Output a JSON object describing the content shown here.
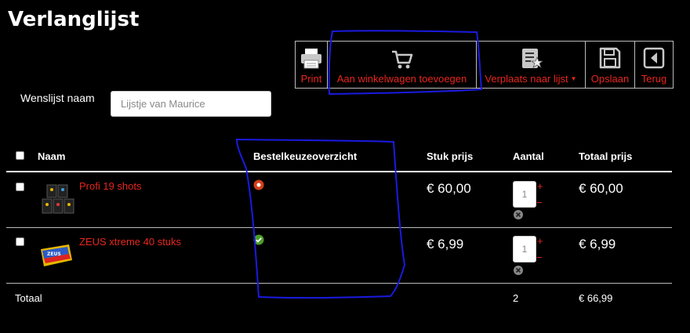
{
  "page": {
    "title": "Verlanglijst"
  },
  "toolbar": {
    "print_label": "Print",
    "add_to_cart_label": "Aan winkelwagen toevoegen",
    "move_to_list_label": "Verplaats naar lijst",
    "save_label": "Opslaan",
    "back_label": "Terug"
  },
  "wishlist": {
    "name_label": "Wenslijst naam",
    "name_value": "",
    "name_placeholder": "Lijstje van Maurice"
  },
  "table": {
    "headers": {
      "name": "Naam",
      "overview": "Bestelkeuzeoverzicht",
      "unit_price": "Stuk prijs",
      "quantity": "Aantal",
      "total_price": "Totaal prijs"
    },
    "rows": [
      {
        "name": "Profi 19 shots",
        "status": "unavailable",
        "unit_price": "€ 60,00",
        "quantity": "1",
        "total": "€ 60,00"
      },
      {
        "name": "ZEUS xtreme 40 stuks",
        "status": "available",
        "unit_price": "€ 6,99",
        "quantity": "1",
        "total": "€ 6,99"
      }
    ],
    "footer": {
      "label": "Totaal",
      "quantity_total": "2",
      "price_total": "€ 66,99"
    },
    "plus_symbol": "+",
    "minus_symbol": "−"
  },
  "colors": {
    "accent": "#e8261e",
    "annotation": "#1a1ae0",
    "status_ok": "#4a9d2a",
    "status_warn": "#d2401a"
  },
  "icons": [
    "printer-icon",
    "cart-icon",
    "list-icon",
    "floppy-disk-icon",
    "back-arrow-icon",
    "remove-icon"
  ]
}
